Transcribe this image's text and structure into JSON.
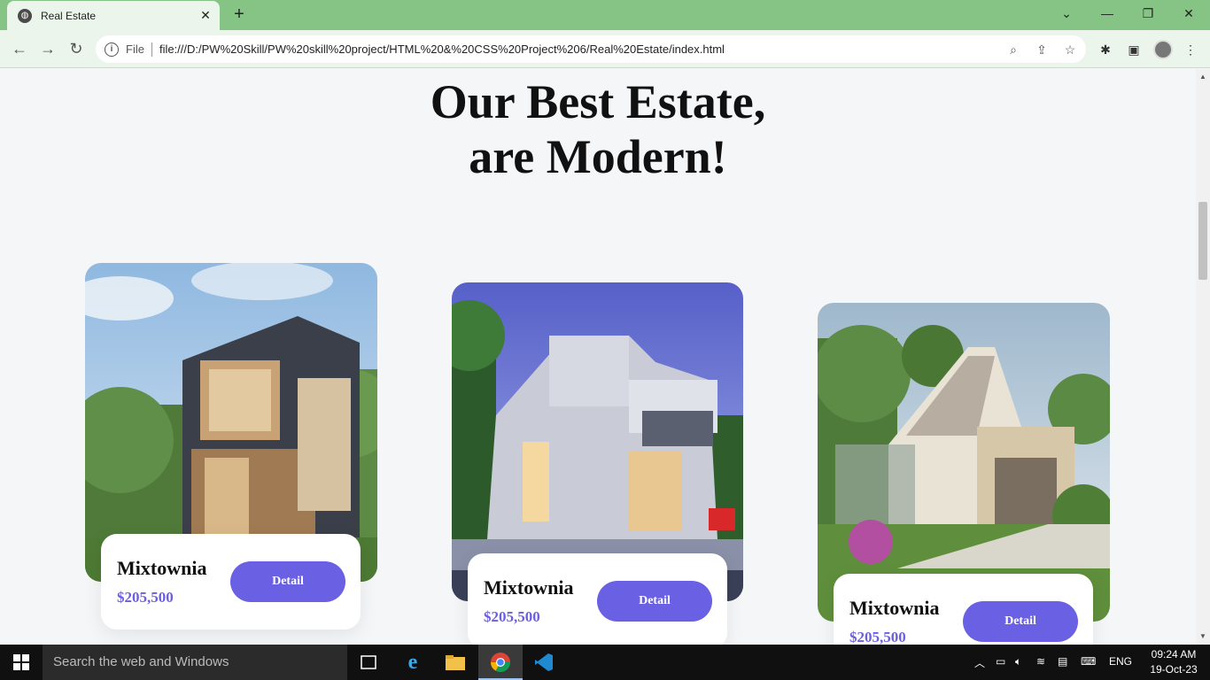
{
  "browser": {
    "tab_title": "Real Estate",
    "file_label": "File",
    "url": "file:///D:/PW%20Skill/PW%20skill%20project/HTML%20&%20CSS%20Project%206/Real%20Estate/index.html"
  },
  "page": {
    "headline_line1": "Our Best Estate,",
    "headline_line2": "are Modern!",
    "cards": [
      {
        "name": "Mixtownia",
        "price": "$205,500",
        "button": "Detail",
        "image": "modern-wood-house-photo"
      },
      {
        "name": "Mixtownia",
        "price": "$205,500",
        "button": "Detail",
        "image": "white-villa-dusk-photo"
      },
      {
        "name": "Mixtownia",
        "price": "$205,500",
        "button": "Detail",
        "image": "cottage-garage-photo"
      }
    ],
    "accent_color": "#6a60e4"
  },
  "taskbar": {
    "search_placeholder": "Search the web and Windows",
    "language": "ENG",
    "time": "09:24 AM",
    "date": "19-Oct-23"
  }
}
